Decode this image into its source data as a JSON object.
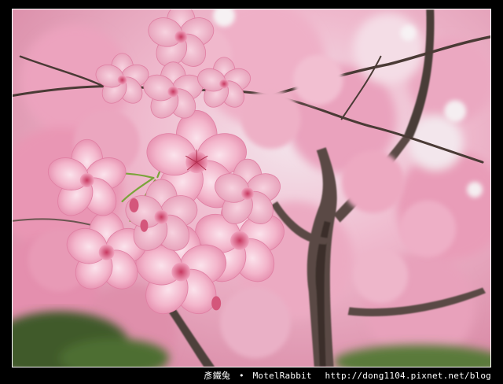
{
  "photo": {
    "subject": "",
    "colors": {
      "blossom_light": "#f6c6d8",
      "blossom_mid": "#e890b0",
      "blossom_deep": "#c8506f",
      "blossom_center": "#b03050",
      "sky": "#f2eef0",
      "bark": "#5a4a44",
      "bark_dark": "#3a2e2a",
      "leaf_green": "#7aa43a",
      "ground_green": "#3f5a2a",
      "frame": "#000000"
    }
  },
  "watermark": {
    "author": "彥鐵兔",
    "separator": "•",
    "brand": "MotelRabbit",
    "url": "http://dong1104.pixnet.net/blog"
  }
}
